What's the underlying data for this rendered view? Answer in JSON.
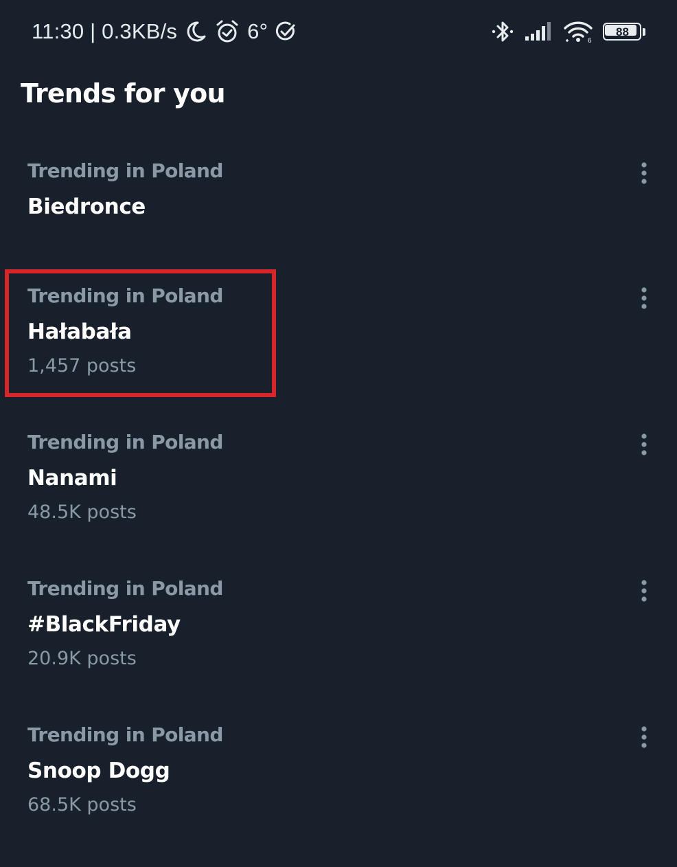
{
  "status_bar": {
    "time_speed": "11:30 | 0.3KB/s",
    "temperature": "6°",
    "battery_level": "88",
    "icons": [
      "moon-icon",
      "alarm-icon",
      "check-circle-icon",
      "bluetooth-icon",
      "cell-signal-icon",
      "wifi-icon",
      "battery-icon"
    ],
    "icon_color": "#e9ecef"
  },
  "header": {
    "title": "Trends for you"
  },
  "trends": [
    {
      "context": "Trending in Poland",
      "name": "Biedronce",
      "posts": ""
    },
    {
      "context": "Trending in Poland",
      "name": "Hałabała",
      "posts": "1,457 posts"
    },
    {
      "context": "Trending in Poland",
      "name": "Nanami",
      "posts": "48.5K posts"
    },
    {
      "context": "Trending in Poland",
      "name": "#BlackFriday",
      "posts": "20.9K posts"
    },
    {
      "context": "Trending in Poland",
      "name": "Snoop Dogg",
      "posts": "68.5K posts"
    }
  ],
  "colors": {
    "background": "#17202b",
    "primary_text": "#ffffff",
    "secondary_text": "#8b98a5",
    "highlight": "#d7262a"
  }
}
